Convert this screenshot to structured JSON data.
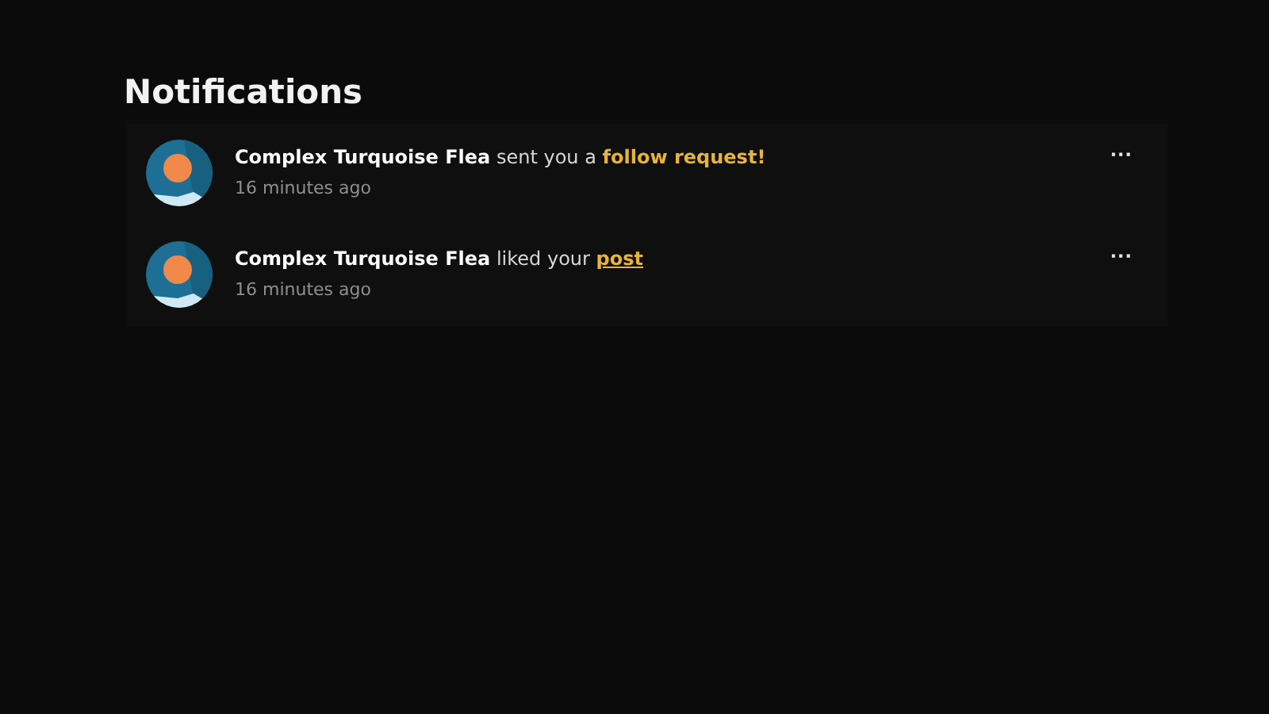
{
  "title": "Notifications",
  "notifications": [
    {
      "actor": "Complex Turquoise Flea",
      "action": "sent you a",
      "link": {
        "text": "follow request!",
        "underlined": false
      },
      "time": "16 minutes ago",
      "menu": "···"
    },
    {
      "actor": "Complex Turquoise Flea",
      "action": "liked your",
      "link": {
        "text": "post",
        "underlined": true
      },
      "time": "16 minutes ago",
      "menu": "···"
    }
  ]
}
